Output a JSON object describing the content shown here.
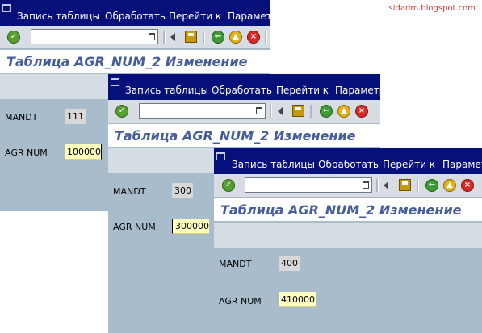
{
  "watermark": "sidadm.blogspot.com",
  "windows": [
    {
      "menu": [
        "Запись таблицы",
        "Обработать",
        "Перейти к",
        "Параметры"
      ],
      "title": "Таблица AGR_NUM_2 Изменение",
      "fields": [
        {
          "label": "MANDT",
          "value": "111"
        },
        {
          "label": "AGR NUM",
          "value": "100000"
        }
      ]
    },
    {
      "menu": [
        "Запись таблицы",
        "Обработать",
        "Перейти к",
        "Параметры"
      ],
      "title": "Таблица AGR_NUM_2 Изменение",
      "fields": [
        {
          "label": "MANDT",
          "value": "300"
        },
        {
          "label": "AGR NUM",
          "value": "300000"
        }
      ]
    },
    {
      "menu": [
        "Запись таблицы",
        "Обработать",
        "Перейти к",
        "Параметры"
      ],
      "title": "Таблица AGR_NUM_2 Изменение",
      "fields": [
        {
          "label": "MANDT",
          "value": "400"
        },
        {
          "label": "AGR NUM",
          "value": "410000"
        }
      ]
    }
  ],
  "icons": {
    "ok": "checkmark-icon",
    "save": "save-icon",
    "back": "back-icon",
    "exit": "exit-icon",
    "cancel": "cancel-icon"
  },
  "colors": {
    "menu_bg": "#06107a",
    "title_text": "#455d9a",
    "content_bg": "#a9bccb",
    "editable_field_bg": "#ffffc0"
  }
}
